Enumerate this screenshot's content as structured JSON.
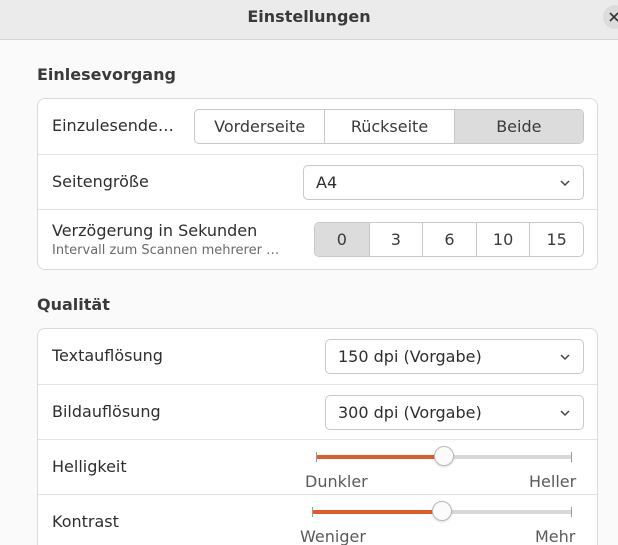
{
  "window": {
    "title": "Einstellungen",
    "close_icon": "close-icon"
  },
  "scan_section": {
    "title": "Einlesevorgang",
    "pages_row": {
      "label": "Einzulesende…",
      "options": [
        "Vorderseite",
        "Rückseite",
        "Beide"
      ],
      "selected": "Beide"
    },
    "page_size_row": {
      "label": "Seitengröße",
      "value": "A4"
    },
    "delay_row": {
      "label": "Verzögerung in Sekunden",
      "sublabel": "Intervall zum Scannen mehrerer …",
      "options": [
        "0",
        "3",
        "6",
        "10",
        "15"
      ],
      "selected": "0"
    }
  },
  "quality_section": {
    "title": "Qualität",
    "text_res_row": {
      "label": "Textauflösung",
      "value": "150 dpi (Vorgabe)"
    },
    "image_res_row": {
      "label": "Bildauflösung",
      "value": "300 dpi (Vorgabe)"
    },
    "brightness_row": {
      "label": "Helligkeit",
      "min_label": "Dunkler",
      "max_label": "Heller",
      "value": 0.5
    },
    "contrast_row": {
      "label": "Kontrast",
      "min_label": "Weniger",
      "max_label": "Mehr",
      "value": 0.5
    }
  },
  "colors": {
    "accent": "#e05a2a",
    "segment_active": "#dcdcdc"
  }
}
